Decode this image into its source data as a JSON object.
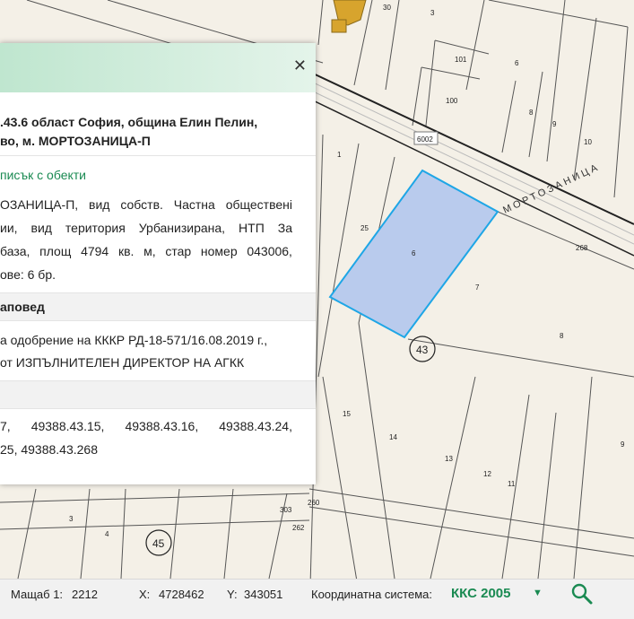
{
  "map": {
    "road_name": "МОРТОЗАНИЦА",
    "road_number": "6002",
    "parcel_labels": [
      "30",
      "3",
      "6",
      "101",
      "100",
      "8",
      "9",
      "10",
      "1",
      "25",
      "6",
      "268",
      "7",
      "8",
      "43",
      "15",
      "14",
      "13",
      "12",
      "11",
      "9",
      "303",
      "262",
      "260",
      "4",
      "3",
      "45"
    ]
  },
  "panel": {
    "title_line1": ".43.6 област София, община Елин Пелин,",
    "title_line2": "во, м. МОРТОЗАНИЦА-П",
    "list_link": "писък с обекти",
    "description": [
      [
        "ОЗАНИЦА-П,",
        "вид",
        "собств.",
        "Частна",
        "общественi"
      ],
      [
        "ии,",
        "вид",
        "територия",
        "Урбанизирана,",
        "НТП",
        "За"
      ],
      [
        "база,",
        "площ",
        "4794",
        "кв.",
        "м,",
        "стар",
        "номер",
        "043006,"
      ],
      [
        "ове: 6 бр."
      ]
    ],
    "section_order": "аповед",
    "order_line1": "а одобрение на КККР РД-18-571/16.08.2019 г.,",
    "order_line2": "от ИЗПЪЛНИТЕЛЕН ДИРЕКТОР НА АГКК",
    "neighbors_line1": [
      "7,",
      "49388.43.15,",
      "49388.43.16,",
      "49388.43.24,"
    ],
    "neighbors_line2": "25, 49388.43.268"
  },
  "statusbar": {
    "scale_label": "Мащаб 1:",
    "scale_value": "2212",
    "x_label": "X:",
    "x_value": "4728462",
    "y_label": "Y:",
    "y_value": "343051",
    "crs_label": "Координатна система:",
    "crs_value": "ККС 2005"
  },
  "colors": {
    "accent": "#1a8a52",
    "parcel_highlight_fill": "#b9cbed",
    "parcel_highlight_stroke": "#1ea6e6"
  }
}
